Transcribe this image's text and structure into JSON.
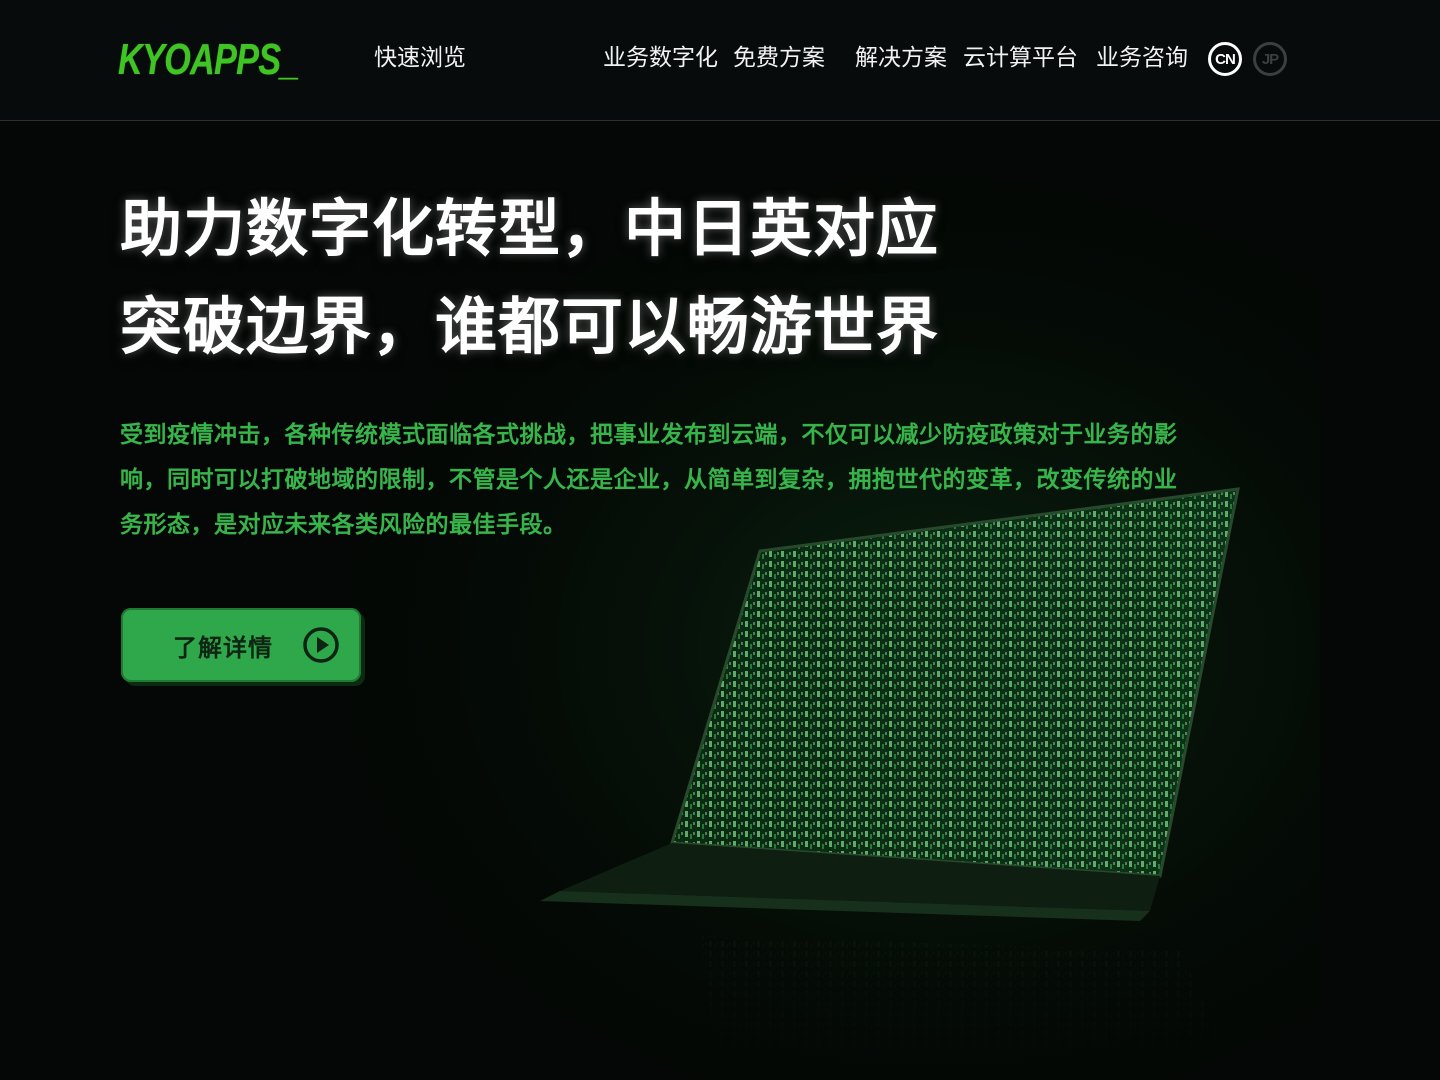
{
  "header": {
    "logo_text": "KYOAPPS_",
    "quick_browse": "快速浏览",
    "nav_items": [
      "业务数字化",
      "免费方案",
      "解决方案",
      "云计算平台",
      "业务咨询"
    ],
    "languages": [
      {
        "label": "CN",
        "active": true
      },
      {
        "label": "JP",
        "active": false
      }
    ]
  },
  "hero": {
    "headline_line1": "助力数字化转型，中日英对应",
    "headline_line2": "突破边界，谁都可以畅游世界",
    "description": "受到疫情冲击，各种传统模式面临各式挑战，把事业发布到云端，不仅可以减少防疫政策对于业务的影响，同时可以打破地域的限制，不管是个人还是企业，从简单到复杂，拥抱世代的变革，改变传统的业务形态，是对应未来各类风险的最佳手段。",
    "cta_label": "了解详情",
    "cta_icon": "play-circle-icon"
  },
  "colors": {
    "accent_green": "#2ea84a",
    "text_green": "#38b54a",
    "logo_green": "#3fc424",
    "background": "#040705"
  }
}
